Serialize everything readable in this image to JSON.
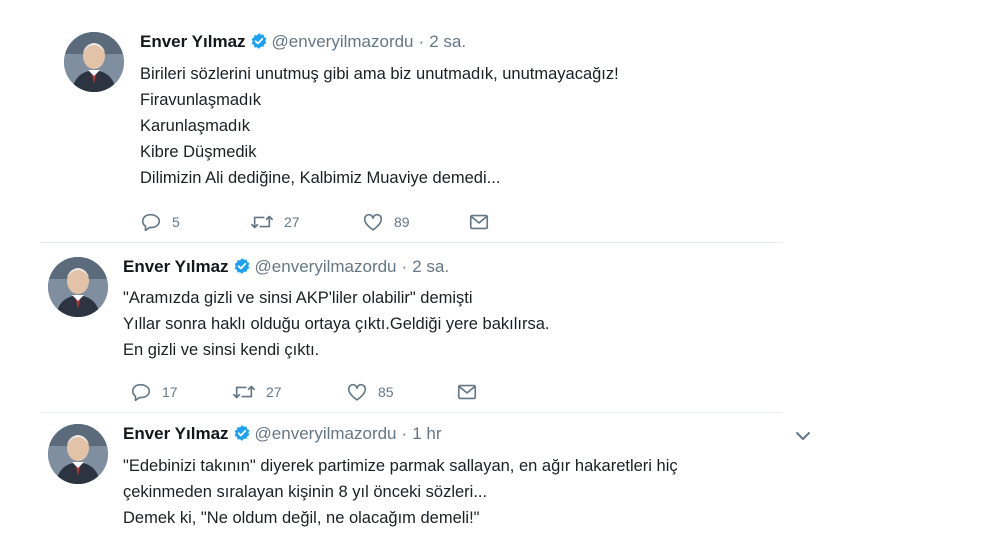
{
  "colors": {
    "text": "#1c2022",
    "muted": "#657786",
    "verified": "#1da1f2",
    "divider": "#e6ecf0"
  },
  "tweets": [
    {
      "name": "Enver Yılmaz",
      "handle": "@enveryilmazordu",
      "separator": "·",
      "time": "2 sa.",
      "lines": [
        "Birileri sözlerini unutmuş gibi ama biz unutmadık, unutmayacağız!",
        "Firavunlaşmadık",
        "Karunlaşmadık",
        "Kibre Düşmedik",
        "Dilimizin Ali dediğine, Kalbimiz Muaviye demedi..."
      ],
      "replies": "5",
      "retweets": "27",
      "likes": "89"
    },
    {
      "name": "Enver Yılmaz",
      "handle": "@enveryilmazordu",
      "separator": "·",
      "time": "2 sa.",
      "lines": [
        "\"Aramızda gizli ve sinsi AKP'liler olabilir\" demişti",
        "Yıllar sonra haklı olduğu ortaya çıktı.Geldiği yere bakılırsa.",
        "En gizli ve sinsi kendi çıktı."
      ],
      "replies": "17",
      "retweets": "27",
      "likes": "85"
    },
    {
      "name": "Enver Yılmaz",
      "handle": "@enveryilmazordu",
      "separator": "·",
      "time": "1 hr",
      "lines": [
        "\"Edebinizi takının\" diyerek partimize parmak sallayan, en ağır hakaretleri hiç",
        "çekinmeden sıralayan kişinin 8 yıl önceki sözleri...",
        "Demek ki, \"Ne oldum değil, ne olacağım demeli!\""
      ],
      "icons": {
        "menu": "chevron-down-icon"
      }
    }
  ],
  "icons": {
    "reply": "reply-icon",
    "retweet": "retweet-icon",
    "like": "heart-icon",
    "dm": "envelope-icon",
    "verified": "verified-badge-icon"
  }
}
